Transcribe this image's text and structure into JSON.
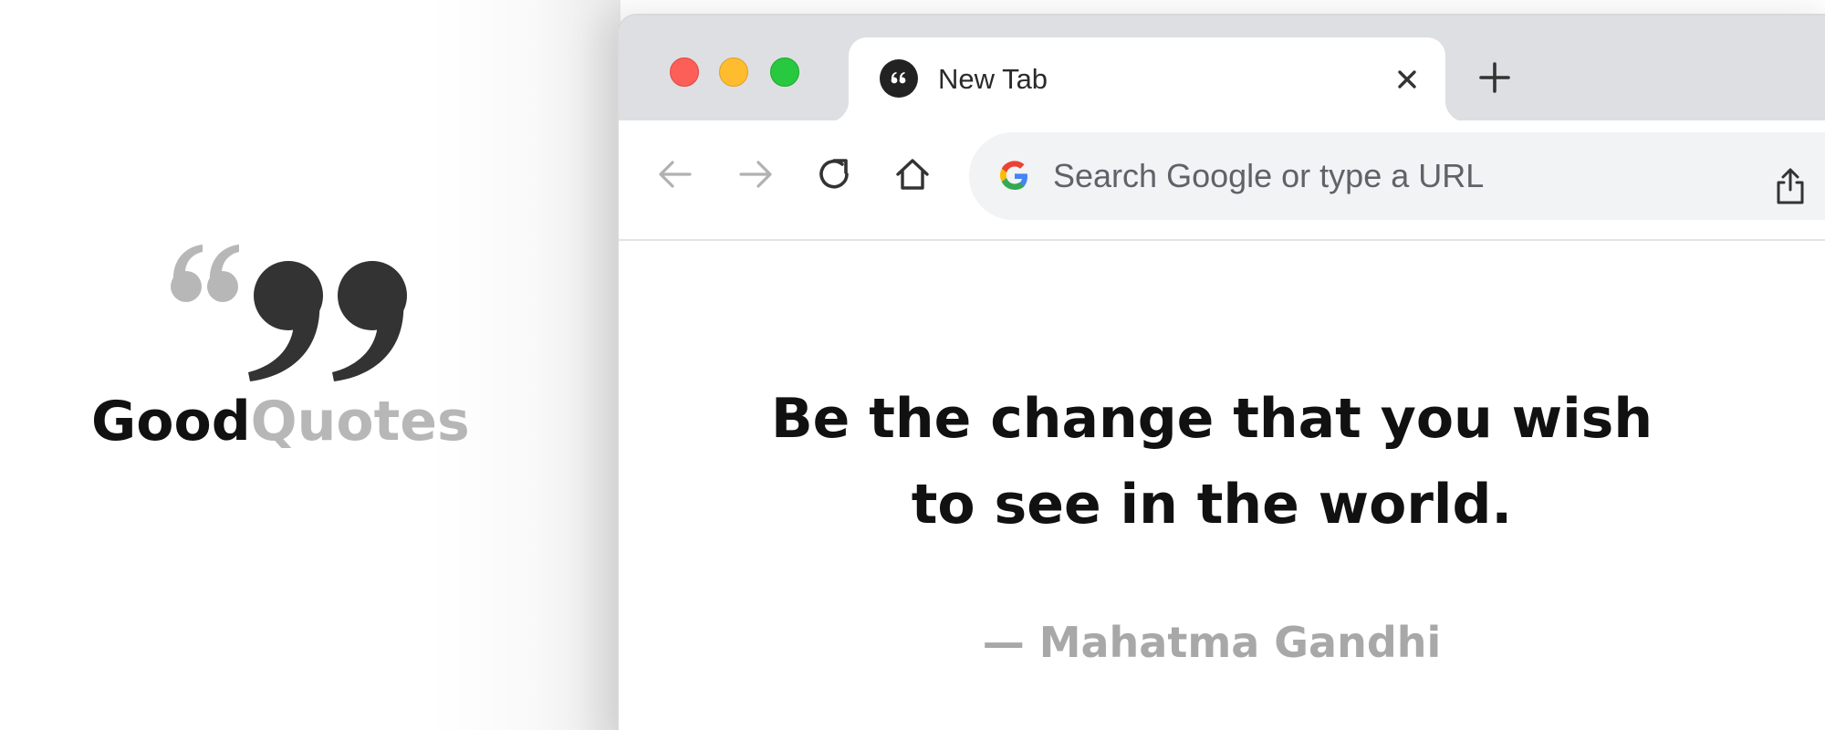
{
  "logo": {
    "word_good": "Good",
    "word_quotes": "Quotes",
    "icon": "quote-marks-icon"
  },
  "browser": {
    "tab": {
      "title": "New Tab",
      "favicon": "quote-favicon-icon",
      "close_icon": "close-icon"
    },
    "new_tab_icon": "plus-icon",
    "toolbar": {
      "back_icon": "arrow-left-icon",
      "forward_icon": "arrow-right-icon",
      "reload_icon": "reload-icon",
      "home_icon": "home-icon",
      "share_icon": "share-icon"
    },
    "omnibox": {
      "placeholder": "Search Google or type a URL",
      "value": "",
      "search_engine_icon": "google-g-icon"
    }
  },
  "page": {
    "quote_line1": "Be the change that you wish",
    "quote_line2": "to see in the world.",
    "author": "— Mahatma Gandhi"
  },
  "colors": {
    "tabstrip": "#dedfe3",
    "omnibox": "#f1f3f4",
    "traffic_red": "#fc5f57",
    "traffic_yellow": "#febc2e",
    "traffic_green": "#28c840",
    "logo_gray": "#b7b7b7",
    "author_gray": "#a8a8a8"
  }
}
